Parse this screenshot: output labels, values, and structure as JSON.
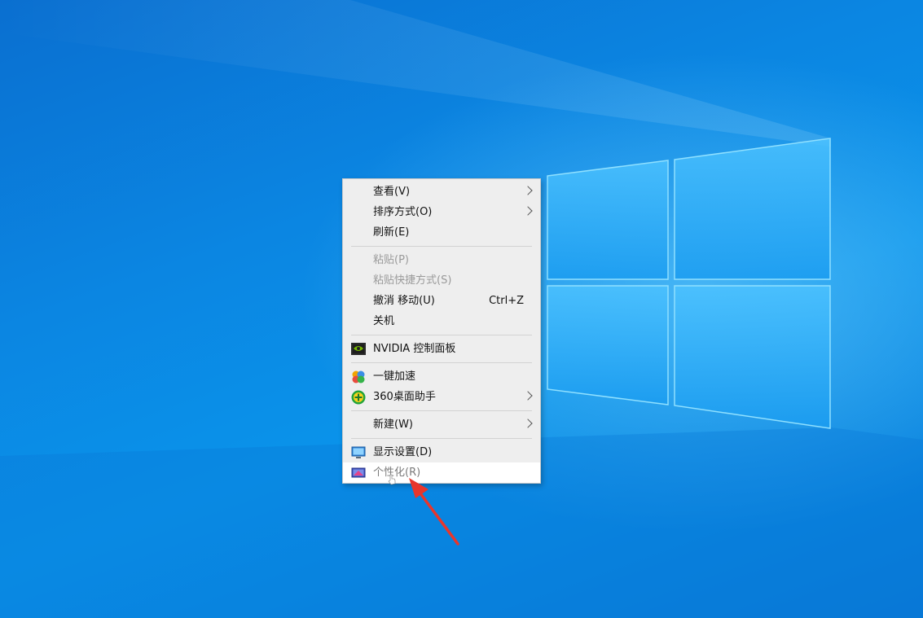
{
  "context_menu": {
    "items": [
      {
        "label": "查看(V)",
        "submenu": true
      },
      {
        "label": "排序方式(O)",
        "submenu": true
      },
      {
        "label": "刷新(E)"
      },
      {
        "label": "粘贴(P)",
        "disabled": true
      },
      {
        "label": "粘贴快捷方式(S)",
        "disabled": true
      },
      {
        "label": "撤消 移动(U)",
        "shortcut": "Ctrl+Z"
      },
      {
        "label": "关机"
      },
      {
        "label": "NVIDIA 控制面板",
        "icon": "nvidia-icon"
      },
      {
        "label": "一键加速",
        "icon": "speedup-icon"
      },
      {
        "label": "360桌面助手",
        "icon": "360-icon",
        "submenu": true
      },
      {
        "label": "新建(W)",
        "submenu": true
      },
      {
        "label": "显示设置(D)",
        "icon": "display-settings-icon"
      },
      {
        "label": "个性化(R)",
        "icon": "personalize-icon",
        "highlighted": true
      }
    ]
  },
  "colors": {
    "desktop_blue": "#0b86e2",
    "menu_bg": "#eeeeee",
    "highlight_bg": "#ffffff",
    "arrow_red": "#e8362c"
  }
}
